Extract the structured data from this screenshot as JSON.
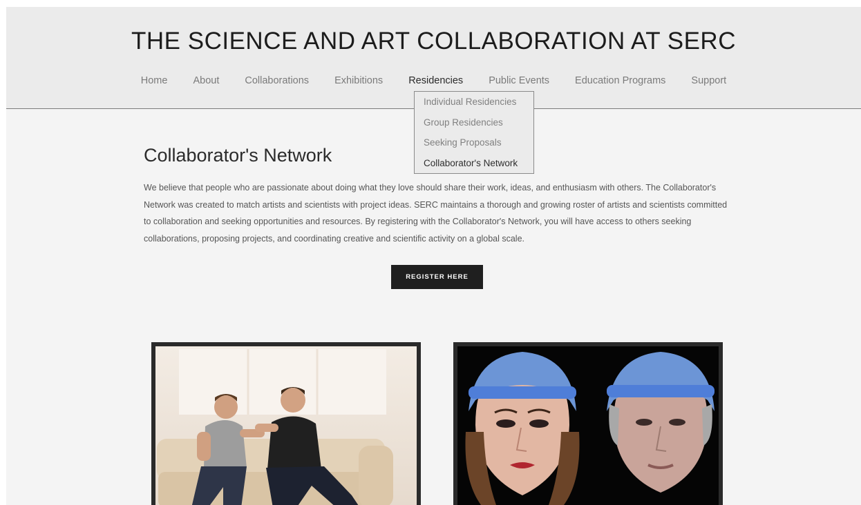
{
  "site": {
    "title": "THE SCIENCE AND ART COLLABORATION AT SERC"
  },
  "nav": {
    "items": [
      {
        "label": "Home"
      },
      {
        "label": "About"
      },
      {
        "label": "Collaborations"
      },
      {
        "label": "Exhibitions"
      },
      {
        "label": "Residencies"
      },
      {
        "label": "Public Events"
      },
      {
        "label": "Education Programs"
      },
      {
        "label": "Support"
      }
    ],
    "active": "Residencies"
  },
  "dropdown": {
    "items": [
      {
        "label": "Individual Residencies"
      },
      {
        "label": "Group Residencies"
      },
      {
        "label": "Seeking Proposals"
      },
      {
        "label": "Collaborator's Network"
      }
    ],
    "current": "Collaborator's Network"
  },
  "content": {
    "heading": "Collaborator's Network",
    "paragraph": "We believe that people who are passionate about doing what they love should share their work, ideas, and enthusiasm with others. The Collaborator's Network was created to match artists and scientists with project ideas. SERC maintains a thorough and growing roster of artists and scientists committed to collaboration and seeking opportunities and resources. By registering with the Collaborator's Network, you will have access to others seeking collaborations, proposing projects, and coordinating creative and scientific activity on a global scale.",
    "register_label": "REGISTER HERE"
  },
  "images": [
    {
      "name": "two-men-on-couch-photo"
    },
    {
      "name": "3d-face-scans-photo"
    }
  ]
}
